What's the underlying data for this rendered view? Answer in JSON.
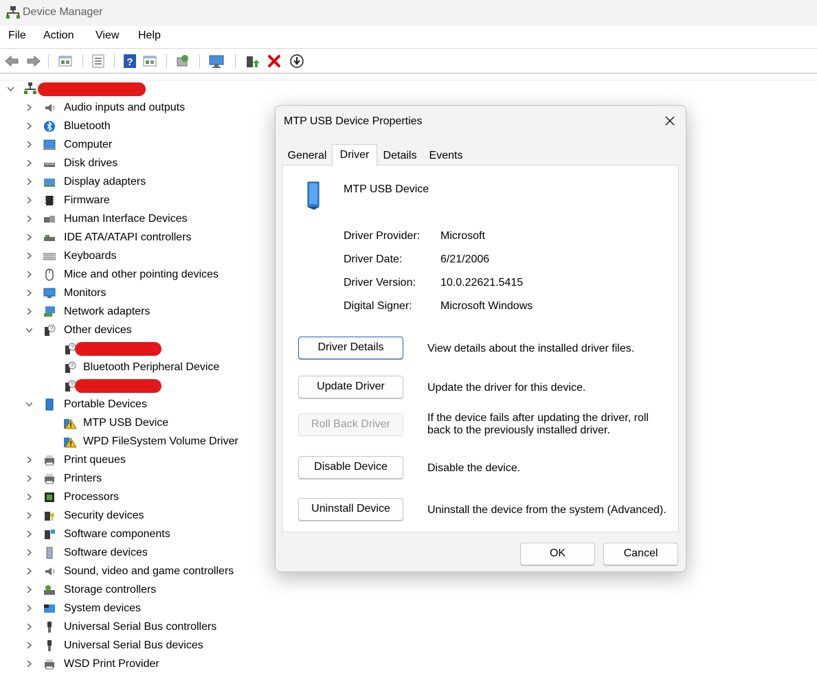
{
  "window": {
    "title": "Device Manager"
  },
  "menu": [
    "File",
    "Action",
    "View",
    "Help"
  ],
  "toolbar": {
    "icons": [
      "back-arrow-icon",
      "forward-arrow-icon",
      "properties-icon",
      "update-view-icon",
      "help-icon",
      "show-hidden-icon",
      "scan-hardware-icon",
      "monitor-icon",
      "update-driver-icon",
      "uninstall-icon",
      "download-icon"
    ]
  },
  "tree": {
    "root": {
      "label": "",
      "redacted": true
    },
    "categories": [
      {
        "label": "Audio inputs and outputs",
        "icon": "speaker-icon"
      },
      {
        "label": "Bluetooth",
        "icon": "bluetooth-icon"
      },
      {
        "label": "Computer",
        "icon": "computer-icon"
      },
      {
        "label": "Disk drives",
        "icon": "disk-drive-icon"
      },
      {
        "label": "Display adapters",
        "icon": "display-adapter-icon"
      },
      {
        "label": "Firmware",
        "icon": "firmware-icon"
      },
      {
        "label": "Human Interface Devices",
        "icon": "hid-icon"
      },
      {
        "label": "IDE ATA/ATAPI controllers",
        "icon": "ide-controller-icon"
      },
      {
        "label": "Keyboards",
        "icon": "keyboard-icon"
      },
      {
        "label": "Mice and other pointing devices",
        "icon": "mouse-icon"
      },
      {
        "label": "Monitors",
        "icon": "monitor-icon"
      },
      {
        "label": "Network adapters",
        "icon": "network-adapter-icon"
      },
      {
        "label": "Other devices",
        "icon": "unknown-device-icon",
        "expanded": true
      },
      {
        "label": "Portable Devices",
        "icon": "portable-device-icon",
        "expanded": true
      },
      {
        "label": "Print queues",
        "icon": "printer-icon"
      },
      {
        "label": "Printers",
        "icon": "printer-icon"
      },
      {
        "label": "Processors",
        "icon": "processor-icon"
      },
      {
        "label": "Security devices",
        "icon": "security-device-icon"
      },
      {
        "label": "Software components",
        "icon": "software-component-icon"
      },
      {
        "label": "Software devices",
        "icon": "software-device-icon"
      },
      {
        "label": "Sound, video and game controllers",
        "icon": "speaker-icon"
      },
      {
        "label": "Storage controllers",
        "icon": "storage-controller-icon"
      },
      {
        "label": "System devices",
        "icon": "system-device-icon"
      },
      {
        "label": "Universal Serial Bus controllers",
        "icon": "usb-icon"
      },
      {
        "label": "Universal Serial Bus devices",
        "icon": "usb-icon"
      },
      {
        "label": "WSD Print Provider",
        "icon": "printer-icon"
      }
    ],
    "other_devices_children": [
      {
        "label": "",
        "redacted": true
      },
      {
        "label": "Bluetooth Peripheral Device"
      },
      {
        "label": "",
        "redacted": true
      }
    ],
    "portable_devices_children": [
      {
        "label": "MTP USB Device"
      },
      {
        "label": "WPD FileSystem Volume Driver"
      }
    ]
  },
  "dialog": {
    "title": "MTP USB Device Properties",
    "tabs": [
      "General",
      "Driver",
      "Details",
      "Events"
    ],
    "active_tab": "Driver",
    "device_name": "MTP USB Device",
    "info": [
      {
        "label": "Driver Provider:",
        "value": "Microsoft"
      },
      {
        "label": "Driver Date:",
        "value": "6/21/2006"
      },
      {
        "label": "Driver Version:",
        "value": "10.0.22621.5415"
      },
      {
        "label": "Digital Signer:",
        "value": "Microsoft Windows"
      }
    ],
    "actions": [
      {
        "label": "Driver Details",
        "desc": "View details about the installed driver files.",
        "enabled": true
      },
      {
        "label": "Update Driver",
        "desc": "Update the driver for this device.",
        "enabled": true
      },
      {
        "label": "Roll Back Driver",
        "desc_line1": "If the device fails after updating the driver, roll",
        "desc_line2": "back to the previously installed driver.",
        "enabled": false
      },
      {
        "label": "Disable Device",
        "desc": "Disable the device.",
        "enabled": true
      },
      {
        "label": "Uninstall Device",
        "desc": "Uninstall the device from the system (Advanced).",
        "enabled": true
      }
    ],
    "ok_label": "OK",
    "cancel_label": "Cancel"
  }
}
